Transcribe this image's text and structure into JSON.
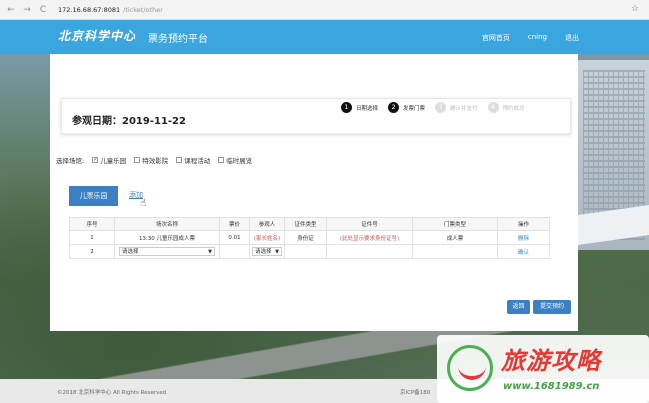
{
  "browser": {
    "back_icon": "←",
    "forward_icon": "→",
    "reload_icon": "C",
    "url_host": "172.16.68.67:8081",
    "url_path": "/ticket/other",
    "star_icon": "☆"
  },
  "header": {
    "logo": "北京科学中心",
    "subtitle": "票务预约平台",
    "nav": {
      "home": "官网首页",
      "user": "cning",
      "logout": "退出"
    }
  },
  "visit": {
    "date_label": "参观日期：",
    "date_value": "2019-11-22"
  },
  "steps": [
    {
      "num": "1",
      "label": "日期选择",
      "active": true
    },
    {
      "num": "2",
      "label": "发票门票",
      "active": true
    },
    {
      "num": "3",
      "label": "确认并支付",
      "active": false
    },
    {
      "num": "4",
      "label": "预约成功",
      "active": false
    }
  ],
  "venue": {
    "label": "选择场馆:",
    "options": [
      {
        "label": "儿童乐园",
        "checked": true
      },
      {
        "label": "特效影院",
        "checked": false
      },
      {
        "label": "课程活动",
        "checked": false
      },
      {
        "label": "临时展览",
        "checked": false
      }
    ]
  },
  "tabs": {
    "active": "儿票乐园",
    "add": "添加"
  },
  "table": {
    "headers": [
      "序号",
      "场次名称",
      "票价",
      "参观人",
      "证件类型",
      "证件号",
      "门票类型",
      "操作"
    ],
    "rows": [
      {
        "no": "1",
        "session": "13:30 儿童乐园成人票",
        "price": "0.01",
        "visitor": "(家长姓名)",
        "id_type": "身份证",
        "id_no": "(此处显示要求身份证号)",
        "ticket_type": "成人票",
        "action": "删除"
      },
      {
        "no": "2",
        "session": "请选择",
        "price": "",
        "visitor": "请选择",
        "id_type": "",
        "id_no": "",
        "ticket_type": "",
        "action": "确认"
      }
    ]
  },
  "buttons": {
    "back": "返回",
    "submit": "提交预约"
  },
  "footer": {
    "copyright": "©2018 北京科学中心 All Rights Reserved",
    "icp": "京ICP备180"
  },
  "watermark": {
    "title": "旅游攻略",
    "url": "www.1681989.cn"
  }
}
